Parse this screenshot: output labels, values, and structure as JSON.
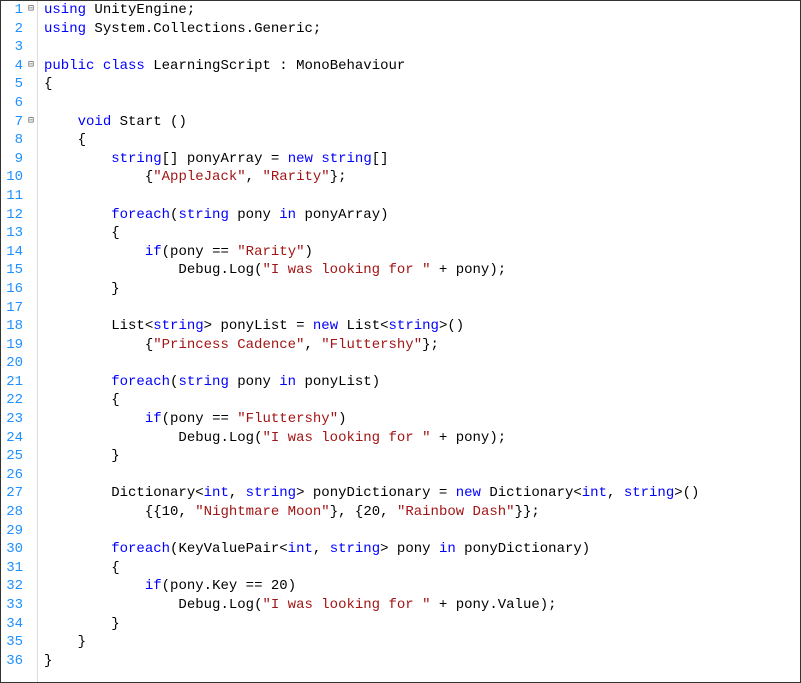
{
  "lines": [
    {
      "num": 1,
      "fold": "⊟",
      "tokens": [
        [
          "kw",
          "using"
        ],
        [
          "",
          ", "
        ],
        [
          "cls",
          "UnityEngine"
        ],
        [
          "",
          ";"
        ]
      ],
      "raw": [
        [
          "kw",
          "using"
        ],
        [
          "",
          " "
        ],
        [
          "cls",
          "UnityEngine"
        ],
        [
          "punct",
          ";"
        ]
      ]
    },
    {
      "num": 2,
      "fold": "",
      "raw": [
        [
          "kw",
          "using"
        ],
        [
          "",
          " "
        ],
        [
          "cls",
          "System"
        ],
        [
          "punct",
          "."
        ],
        [
          "cls",
          "Collections"
        ],
        [
          "punct",
          "."
        ],
        [
          "cls",
          "Generic"
        ],
        [
          "punct",
          ";"
        ]
      ]
    },
    {
      "num": 3,
      "fold": "",
      "raw": [
        [
          "",
          ""
        ]
      ]
    },
    {
      "num": 4,
      "fold": "⊟",
      "raw": [
        [
          "kw",
          "public"
        ],
        [
          "",
          " "
        ],
        [
          "kw",
          "class"
        ],
        [
          "",
          " "
        ],
        [
          "cls",
          "LearningScript"
        ],
        [
          "",
          " "
        ],
        [
          "punct",
          ":"
        ],
        [
          "",
          " "
        ],
        [
          "cls",
          "MonoBehaviour"
        ]
      ]
    },
    {
      "num": 5,
      "fold": "",
      "raw": [
        [
          "punct",
          "{"
        ]
      ]
    },
    {
      "num": 6,
      "fold": "",
      "raw": [
        [
          "",
          ""
        ]
      ]
    },
    {
      "num": 7,
      "fold": "⊟",
      "raw": [
        [
          "",
          "    "
        ],
        [
          "kw",
          "void"
        ],
        [
          "",
          " "
        ],
        [
          "cls",
          "Start"
        ],
        [
          "",
          " "
        ],
        [
          "punct",
          "()"
        ]
      ]
    },
    {
      "num": 8,
      "fold": "",
      "raw": [
        [
          "",
          "    "
        ],
        [
          "punct",
          "{"
        ]
      ]
    },
    {
      "num": 9,
      "fold": "",
      "raw": [
        [
          "",
          "        "
        ],
        [
          "kw",
          "string"
        ],
        [
          "punct",
          "[]"
        ],
        [
          "",
          " ponyArray "
        ],
        [
          "punct",
          "="
        ],
        [
          "",
          " "
        ],
        [
          "kw",
          "new"
        ],
        [
          "",
          " "
        ],
        [
          "kw",
          "string"
        ],
        [
          "punct",
          "[]"
        ]
      ]
    },
    {
      "num": 10,
      "fold": "",
      "raw": [
        [
          "",
          "            "
        ],
        [
          "punct",
          "{"
        ],
        [
          "str",
          "\"AppleJack\""
        ],
        [
          "punct",
          ","
        ],
        [
          "",
          " "
        ],
        [
          "str",
          "\"Rarity\""
        ],
        [
          "punct",
          "};"
        ]
      ]
    },
    {
      "num": 11,
      "fold": "",
      "raw": [
        [
          "",
          ""
        ]
      ]
    },
    {
      "num": 12,
      "fold": "",
      "raw": [
        [
          "",
          "        "
        ],
        [
          "kw",
          "foreach"
        ],
        [
          "punct",
          "("
        ],
        [
          "kw",
          "string"
        ],
        [
          "",
          " pony "
        ],
        [
          "kw",
          "in"
        ],
        [
          "",
          " ponyArray"
        ],
        [
          "punct",
          ")"
        ]
      ]
    },
    {
      "num": 13,
      "fold": "",
      "raw": [
        [
          "",
          "        "
        ],
        [
          "punct",
          "{"
        ]
      ]
    },
    {
      "num": 14,
      "fold": "",
      "raw": [
        [
          "",
          "            "
        ],
        [
          "kw",
          "if"
        ],
        [
          "punct",
          "("
        ],
        [
          "",
          "pony "
        ],
        [
          "punct",
          "=="
        ],
        [
          "",
          " "
        ],
        [
          "str",
          "\"Rarity\""
        ],
        [
          "punct",
          ")"
        ]
      ]
    },
    {
      "num": 15,
      "fold": "",
      "raw": [
        [
          "",
          "                "
        ],
        [
          "cls",
          "Debug"
        ],
        [
          "punct",
          "."
        ],
        [
          "cls",
          "Log"
        ],
        [
          "punct",
          "("
        ],
        [
          "str",
          "\"I was looking for \""
        ],
        [
          "",
          " "
        ],
        [
          "punct",
          "+"
        ],
        [
          "",
          " pony"
        ],
        [
          "punct",
          ");"
        ]
      ]
    },
    {
      "num": 16,
      "fold": "",
      "raw": [
        [
          "",
          "        "
        ],
        [
          "punct",
          "}"
        ]
      ]
    },
    {
      "num": 17,
      "fold": "",
      "raw": [
        [
          "",
          ""
        ]
      ]
    },
    {
      "num": 18,
      "fold": "",
      "raw": [
        [
          "",
          "        "
        ],
        [
          "cls",
          "List"
        ],
        [
          "punct",
          "<"
        ],
        [
          "kw",
          "string"
        ],
        [
          "punct",
          ">"
        ],
        [
          "",
          " ponyList "
        ],
        [
          "punct",
          "="
        ],
        [
          "",
          " "
        ],
        [
          "kw",
          "new"
        ],
        [
          "",
          " "
        ],
        [
          "cls",
          "List"
        ],
        [
          "punct",
          "<"
        ],
        [
          "kw",
          "string"
        ],
        [
          "punct",
          ">()"
        ]
      ]
    },
    {
      "num": 19,
      "fold": "",
      "raw": [
        [
          "",
          "            "
        ],
        [
          "punct",
          "{"
        ],
        [
          "str",
          "\"Princess Cadence\""
        ],
        [
          "punct",
          ","
        ],
        [
          "",
          " "
        ],
        [
          "str",
          "\"Fluttershy\""
        ],
        [
          "punct",
          "};"
        ]
      ]
    },
    {
      "num": 20,
      "fold": "",
      "raw": [
        [
          "",
          ""
        ]
      ]
    },
    {
      "num": 21,
      "fold": "",
      "raw": [
        [
          "",
          "        "
        ],
        [
          "kw",
          "foreach"
        ],
        [
          "punct",
          "("
        ],
        [
          "kw",
          "string"
        ],
        [
          "",
          " pony "
        ],
        [
          "kw",
          "in"
        ],
        [
          "",
          " ponyList"
        ],
        [
          "punct",
          ")"
        ]
      ]
    },
    {
      "num": 22,
      "fold": "",
      "raw": [
        [
          "",
          "        "
        ],
        [
          "punct",
          "{"
        ]
      ]
    },
    {
      "num": 23,
      "fold": "",
      "raw": [
        [
          "",
          "            "
        ],
        [
          "kw",
          "if"
        ],
        [
          "punct",
          "("
        ],
        [
          "",
          "pony "
        ],
        [
          "punct",
          "=="
        ],
        [
          "",
          " "
        ],
        [
          "str",
          "\"Fluttershy\""
        ],
        [
          "punct",
          ")"
        ]
      ]
    },
    {
      "num": 24,
      "fold": "",
      "raw": [
        [
          "",
          "                "
        ],
        [
          "cls",
          "Debug"
        ],
        [
          "punct",
          "."
        ],
        [
          "cls",
          "Log"
        ],
        [
          "punct",
          "("
        ],
        [
          "str",
          "\"I was looking for \""
        ],
        [
          "",
          " "
        ],
        [
          "punct",
          "+"
        ],
        [
          "",
          " pony"
        ],
        [
          "punct",
          ");"
        ]
      ]
    },
    {
      "num": 25,
      "fold": "",
      "raw": [
        [
          "",
          "        "
        ],
        [
          "punct",
          "}"
        ]
      ]
    },
    {
      "num": 26,
      "fold": "",
      "raw": [
        [
          "",
          ""
        ]
      ]
    },
    {
      "num": 27,
      "fold": "",
      "raw": [
        [
          "",
          "        "
        ],
        [
          "cls",
          "Dictionary"
        ],
        [
          "punct",
          "<"
        ],
        [
          "kw",
          "int"
        ],
        [
          "punct",
          ","
        ],
        [
          "",
          " "
        ],
        [
          "kw",
          "string"
        ],
        [
          "punct",
          ">"
        ],
        [
          "",
          " ponyDictionary "
        ],
        [
          "punct",
          "="
        ],
        [
          "",
          " "
        ],
        [
          "kw",
          "new"
        ],
        [
          "",
          " "
        ],
        [
          "cls",
          "Dictionary"
        ],
        [
          "punct",
          "<"
        ],
        [
          "kw",
          "int"
        ],
        [
          "punct",
          ","
        ],
        [
          "",
          " "
        ],
        [
          "kw",
          "string"
        ],
        [
          "punct",
          ">()"
        ]
      ]
    },
    {
      "num": 28,
      "fold": "",
      "raw": [
        [
          "",
          "            "
        ],
        [
          "punct",
          "{{"
        ],
        [
          "",
          "10"
        ],
        [
          "punct",
          ","
        ],
        [
          "",
          " "
        ],
        [
          "str",
          "\"Nightmare Moon\""
        ],
        [
          "punct",
          "},"
        ],
        [
          "",
          " "
        ],
        [
          "punct",
          "{"
        ],
        [
          "",
          "20"
        ],
        [
          "punct",
          ","
        ],
        [
          "",
          " "
        ],
        [
          "str",
          "\"Rainbow Dash\""
        ],
        [
          "punct",
          "}};"
        ]
      ]
    },
    {
      "num": 29,
      "fold": "",
      "raw": [
        [
          "",
          ""
        ]
      ]
    },
    {
      "num": 30,
      "fold": "",
      "raw": [
        [
          "",
          "        "
        ],
        [
          "kw",
          "foreach"
        ],
        [
          "punct",
          "("
        ],
        [
          "cls",
          "KeyValuePair"
        ],
        [
          "punct",
          "<"
        ],
        [
          "kw",
          "int"
        ],
        [
          "punct",
          ","
        ],
        [
          "",
          " "
        ],
        [
          "kw",
          "string"
        ],
        [
          "punct",
          ">"
        ],
        [
          "",
          " pony "
        ],
        [
          "kw",
          "in"
        ],
        [
          "",
          " ponyDictionary"
        ],
        [
          "punct",
          ")"
        ]
      ]
    },
    {
      "num": 31,
      "fold": "",
      "raw": [
        [
          "",
          "        "
        ],
        [
          "punct",
          "{"
        ]
      ]
    },
    {
      "num": 32,
      "fold": "",
      "raw": [
        [
          "",
          "            "
        ],
        [
          "kw",
          "if"
        ],
        [
          "punct",
          "("
        ],
        [
          "",
          "pony"
        ],
        [
          "punct",
          "."
        ],
        [
          "",
          "Key "
        ],
        [
          "punct",
          "=="
        ],
        [
          "",
          " 20"
        ],
        [
          "punct",
          ")"
        ]
      ]
    },
    {
      "num": 33,
      "fold": "",
      "raw": [
        [
          "",
          "                "
        ],
        [
          "cls",
          "Debug"
        ],
        [
          "punct",
          "."
        ],
        [
          "cls",
          "Log"
        ],
        [
          "punct",
          "("
        ],
        [
          "str",
          "\"I was looking for \""
        ],
        [
          "",
          " "
        ],
        [
          "punct",
          "+"
        ],
        [
          "",
          " pony"
        ],
        [
          "punct",
          "."
        ],
        [
          "",
          "Value"
        ],
        [
          "punct",
          ");"
        ]
      ]
    },
    {
      "num": 34,
      "fold": "",
      "raw": [
        [
          "",
          "        "
        ],
        [
          "punct",
          "}"
        ]
      ]
    },
    {
      "num": 35,
      "fold": "",
      "raw": [
        [
          "",
          "    "
        ],
        [
          "punct",
          "}"
        ]
      ]
    },
    {
      "num": 36,
      "fold": "",
      "raw": [
        [
          "punct",
          "}"
        ]
      ]
    }
  ]
}
